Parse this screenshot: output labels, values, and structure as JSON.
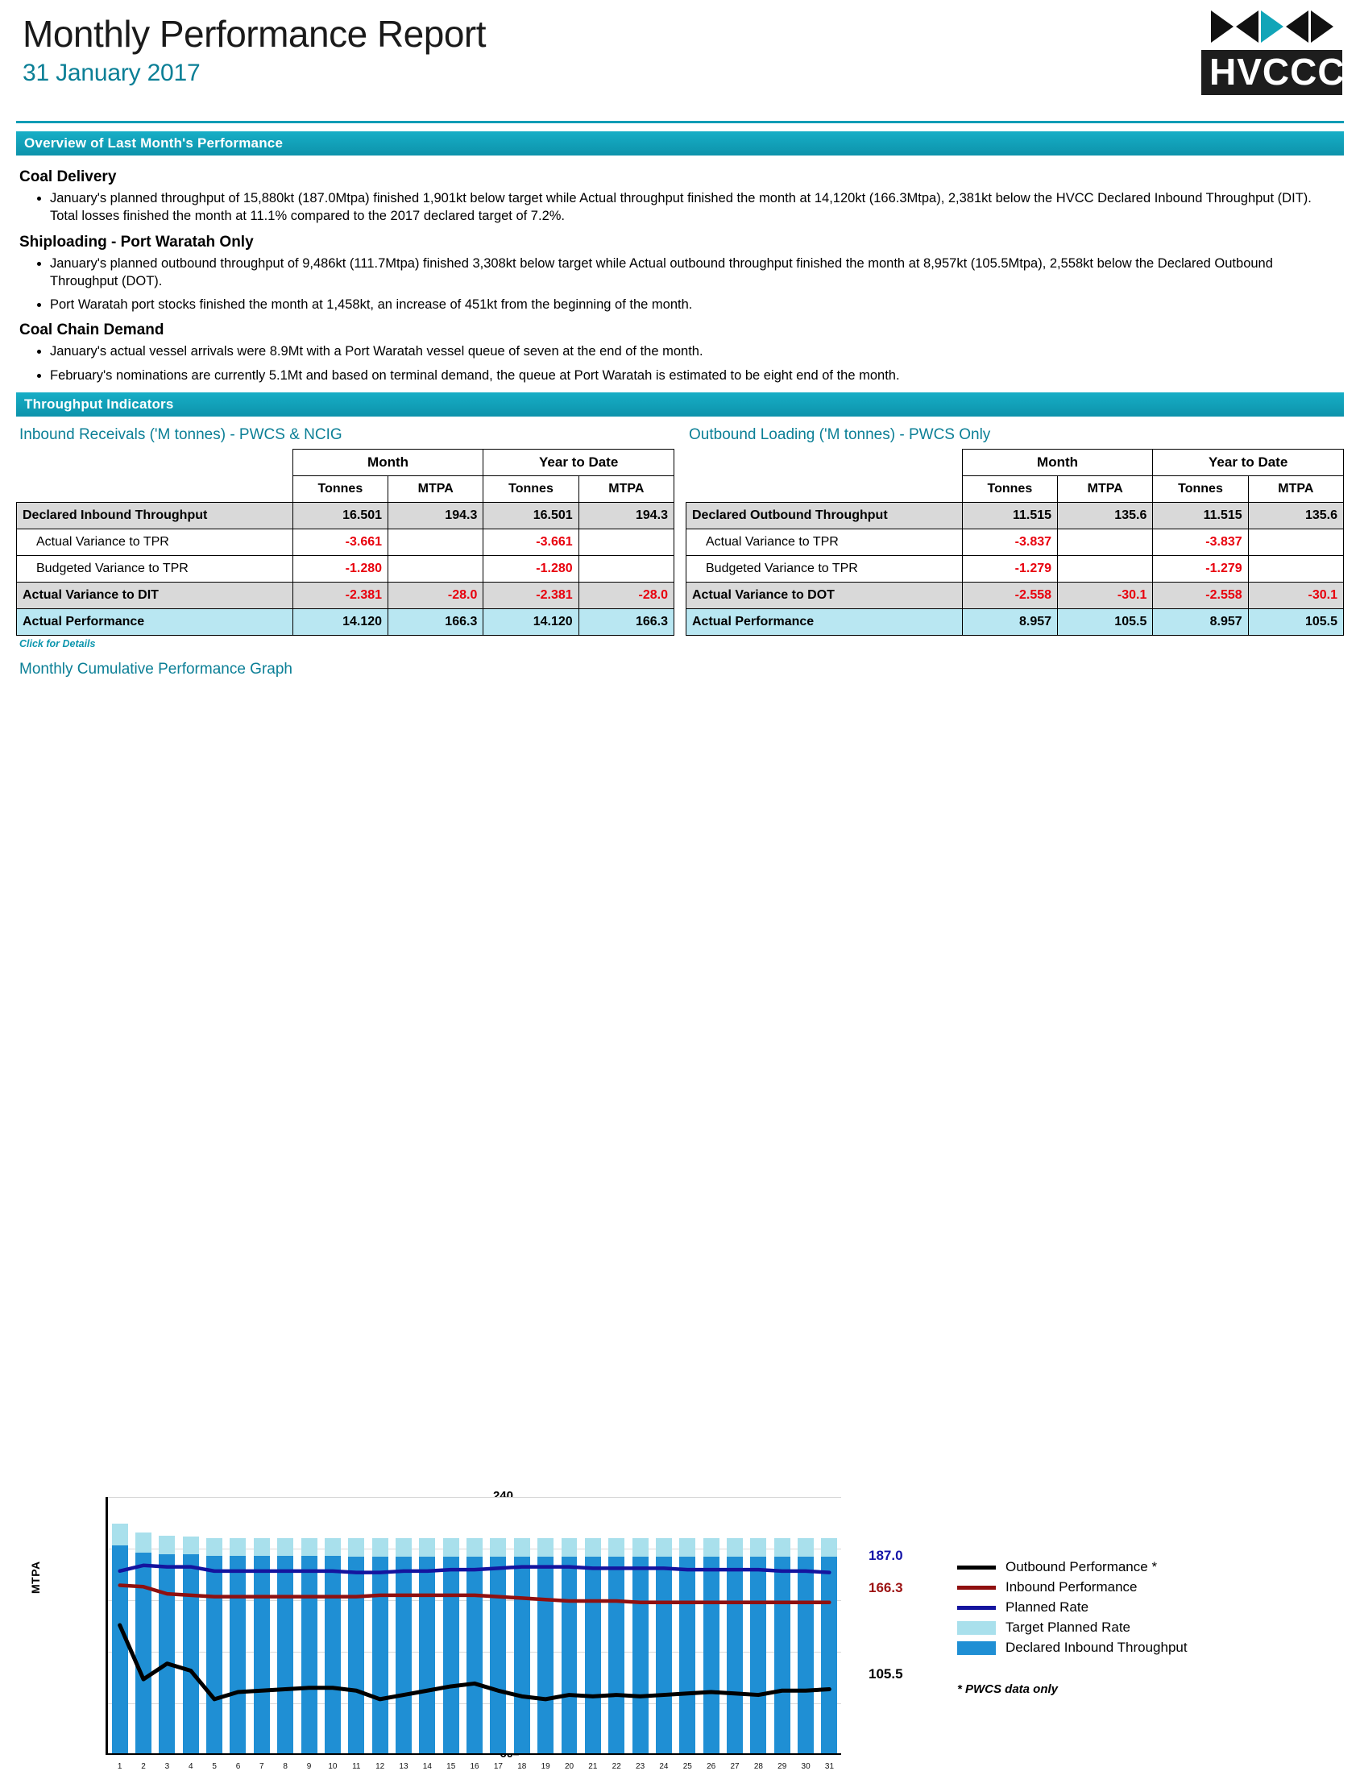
{
  "header": {
    "title": "Monthly Performance Report",
    "date": "31 January 2017",
    "logo_text": "HVCCC"
  },
  "overview": {
    "bar_title": "Overview of Last Month's Performance",
    "groups": [
      {
        "heading": "Coal Delivery",
        "bullets": [
          "January's planned throughput of 15,880kt (187.0Mtpa) finished 1,901kt below target while Actual throughput finished the month at 14,120kt (166.3Mtpa), 2,381kt below the HVCC Declared Inbound Throughput (DIT).  Total losses finished the month at 11.1% compared to the 2017 declared target of 7.2%."
        ]
      },
      {
        "heading": "Shiploading - Port Waratah Only",
        "bullets": [
          "January's planned outbound throughput of 9,486kt (111.7Mtpa) finished 3,308kt below target while Actual outbound throughput finished the month at 8,957kt (105.5Mtpa), 2,558kt below the Declared Outbound Throughput (DOT).",
          "Port Waratah port stocks finished the month at 1,458kt, an increase of 451kt from the beginning of the month."
        ]
      },
      {
        "heading": "Coal Chain Demand",
        "bullets": [
          "January's actual vessel arrivals were 8.9Mt with a Port Waratah vessel queue of seven at the end of the month.",
          "February's nominations are currently 5.1Mt and based on terminal demand, the queue at Port Waratah is estimated to be eight end of the month."
        ]
      }
    ]
  },
  "throughput": {
    "bar_title": "Throughput Indicators",
    "click_details": "Click for Details",
    "col_groups": [
      "Month",
      "Year to Date"
    ],
    "col_subs": [
      "Tonnes",
      "MTPA",
      "Tonnes",
      "MTPA"
    ],
    "inbound": {
      "title": "Inbound Receivals ('M tonnes) - PWCS & NCIG",
      "rows": [
        {
          "label": "Declared Inbound Throughput",
          "style": "grey",
          "indent": false,
          "cells": [
            "16.501",
            "194.3",
            "16.501",
            "194.3"
          ],
          "neg": [
            false,
            false,
            false,
            false
          ]
        },
        {
          "label": "Actual Variance to TPR",
          "style": "plain",
          "indent": true,
          "cells": [
            "-3.661",
            "",
            "-3.661",
            ""
          ],
          "neg": [
            true,
            false,
            true,
            false
          ]
        },
        {
          "label": "Budgeted Variance to TPR",
          "style": "plain",
          "indent": true,
          "cells": [
            "-1.280",
            "",
            "-1.280",
            ""
          ],
          "neg": [
            true,
            false,
            true,
            false
          ]
        },
        {
          "label": "Actual Variance to DIT",
          "style": "grey",
          "indent": false,
          "cells": [
            "-2.381",
            "-28.0",
            "-2.381",
            "-28.0"
          ],
          "neg": [
            true,
            true,
            true,
            true
          ]
        },
        {
          "label": "Actual Performance",
          "style": "cyan",
          "indent": false,
          "cells": [
            "14.120",
            "166.3",
            "14.120",
            "166.3"
          ],
          "neg": [
            false,
            false,
            false,
            false
          ]
        }
      ]
    },
    "outbound": {
      "title": "Outbound Loading ('M tonnes) - PWCS Only",
      "rows": [
        {
          "label": "Declared Outbound Throughput",
          "style": "grey",
          "indent": false,
          "cells": [
            "11.515",
            "135.6",
            "11.515",
            "135.6"
          ],
          "neg": [
            false,
            false,
            false,
            false
          ]
        },
        {
          "label": "Actual Variance to TPR",
          "style": "plain",
          "indent": true,
          "cells": [
            "-3.837",
            "",
            "-3.837",
            ""
          ],
          "neg": [
            true,
            false,
            true,
            false
          ]
        },
        {
          "label": "Budgeted Variance to TPR",
          "style": "plain",
          "indent": true,
          "cells": [
            "-1.279",
            "",
            "-1.279",
            ""
          ],
          "neg": [
            true,
            false,
            true,
            false
          ]
        },
        {
          "label": "Actual Variance to DOT",
          "style": "grey",
          "indent": false,
          "cells": [
            "-2.558",
            "-30.1",
            "-2.558",
            "-30.1"
          ],
          "neg": [
            true,
            true,
            true,
            true
          ]
        },
        {
          "label": "Actual Performance",
          "style": "cyan",
          "indent": false,
          "cells": [
            "8.957",
            "105.5",
            "8.957",
            "105.5"
          ],
          "neg": [
            false,
            false,
            false,
            false
          ]
        }
      ]
    }
  },
  "chart_section": {
    "title": "Monthly Cumulative Performance Graph",
    "end_labels": {
      "planned": "187.0",
      "inbound": "166.3",
      "outbound": "105.5"
    },
    "legend": [
      {
        "name": "Outbound Performance *",
        "type": "line",
        "color": "#000000"
      },
      {
        "name": "Inbound Performance",
        "type": "line",
        "color": "#8f1010"
      },
      {
        "name": "Planned Rate",
        "type": "line",
        "color": "#14149e"
      },
      {
        "name": "Target Planned Rate",
        "type": "box",
        "color": "#a9e0ec"
      },
      {
        "name": "Declared Inbound Throughput",
        "type": "box",
        "color": "#1f8fd4"
      }
    ],
    "note": "* PWCS data only"
  },
  "chart_data": {
    "type": "bar",
    "title": "Monthly Cumulative Performance Graph",
    "xlabel": "",
    "ylabel": "MTPA",
    "ylim": [
      60,
      240
    ],
    "yticks": [
      60,
      96,
      132,
      168,
      204,
      240
    ],
    "grid": true,
    "legend_position": "right",
    "categories": [
      "1",
      "2",
      "3",
      "4",
      "5",
      "6",
      "7",
      "8",
      "9",
      "10",
      "11",
      "12",
      "13",
      "14",
      "15",
      "16",
      "17",
      "18",
      "19",
      "20",
      "21",
      "22",
      "23",
      "24",
      "25",
      "26",
      "27",
      "28",
      "29",
      "30",
      "31"
    ],
    "series": [
      {
        "name": "Target Planned Rate",
        "type": "bar",
        "color": "#a9e0ec",
        "values": [
          220,
          214,
          212,
          211,
          210,
          210,
          210,
          210,
          210,
          210,
          210,
          210,
          210,
          210,
          210,
          210,
          210,
          210,
          210,
          210,
          210,
          210,
          210,
          210,
          210,
          210,
          210,
          210,
          210,
          210,
          210
        ]
      },
      {
        "name": "Declared Inbound Throughput",
        "type": "bar",
        "color": "#1f8fd4",
        "values": [
          205,
          200,
          199,
          199,
          198,
          198,
          198,
          198,
          198,
          198,
          197,
          197,
          197,
          197,
          197,
          197,
          197,
          197,
          197,
          197,
          197,
          197,
          197,
          197,
          197,
          197,
          197,
          197,
          197,
          197,
          197
        ]
      },
      {
        "name": "Planned Rate",
        "type": "line",
        "color": "#14149e",
        "values": [
          188,
          192,
          191,
          191,
          188,
          188,
          188,
          188,
          188,
          188,
          187,
          187,
          188,
          188,
          189,
          189,
          190,
          191,
          191,
          191,
          190,
          190,
          190,
          190,
          189,
          189,
          189,
          189,
          188,
          188,
          187
        ]
      },
      {
        "name": "Inbound Performance",
        "type": "line",
        "color": "#8f1010",
        "values": [
          178,
          177,
          172,
          171,
          170,
          170,
          170,
          170,
          170,
          170,
          170,
          171,
          171,
          171,
          171,
          171,
          170,
          169,
          168,
          167,
          167,
          167,
          166,
          166,
          166,
          166,
          166,
          166,
          166,
          166,
          166
        ]
      },
      {
        "name": "Outbound Performance *",
        "type": "line",
        "color": "#000000",
        "values": [
          150,
          112,
          123,
          118,
          98,
          103,
          104,
          105,
          106,
          106,
          104,
          98,
          101,
          104,
          107,
          109,
          104,
          100,
          98,
          101,
          100,
          101,
          100,
          101,
          102,
          103,
          102,
          101,
          104,
          104,
          105
        ]
      }
    ]
  }
}
